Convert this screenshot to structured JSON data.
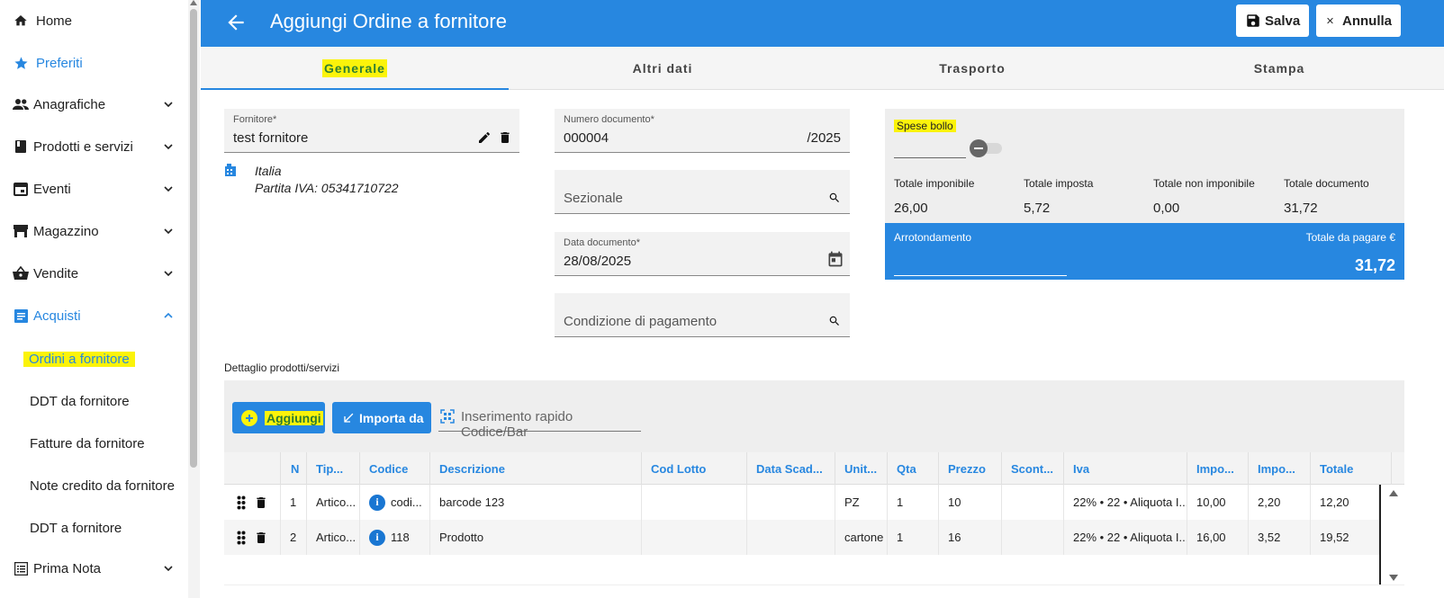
{
  "sidebar": {
    "items": [
      {
        "label": "Home",
        "icon": "home-icon"
      },
      {
        "label": "Preferiti",
        "icon": "star-icon"
      },
      {
        "label": "Anagrafiche",
        "icon": "people-icon"
      },
      {
        "label": "Prodotti e servizi",
        "icon": "book-icon"
      },
      {
        "label": "Eventi",
        "icon": "calendar-icon"
      },
      {
        "label": "Magazzino",
        "icon": "warehouse-icon"
      },
      {
        "label": "Vendite",
        "icon": "basket-icon"
      },
      {
        "label": "Acquisti",
        "icon": "list-icon"
      },
      {
        "label": "Prima Nota",
        "icon": "ledger-icon"
      }
    ],
    "subitems": [
      {
        "label": "Ordini a fornitore"
      },
      {
        "label": "DDT da fornitore"
      },
      {
        "label": "Fatture da fornitore"
      },
      {
        "label": "Note credito da fornitore"
      },
      {
        "label": "DDT a fornitore"
      }
    ]
  },
  "header": {
    "title": "Aggiungi Ordine a fornitore",
    "save_label": "Salva",
    "cancel_label": "Annulla"
  },
  "tabs": [
    {
      "label": "Generale"
    },
    {
      "label": "Altri dati"
    },
    {
      "label": "Trasporto"
    },
    {
      "label": "Stampa"
    }
  ],
  "form": {
    "fornitore_label": "Fornitore*",
    "fornitore_value": "test fornitore",
    "supplier_country": "Italia",
    "supplier_vat": "Partita IVA: 05341710722",
    "numero_label": "Numero documento*",
    "numero_value": "000004",
    "numero_suffix": "/2025",
    "sezionale_placeholder": "Sezionale",
    "data_label": "Data documento*",
    "data_value": "28/08/2025",
    "pagamento_placeholder": "Condizione di pagamento"
  },
  "totals": {
    "spese_bollo_label": "Spese bollo",
    "imponibile_label": "Totale imponibile",
    "imponibile_value": "26,00",
    "imposta_label": "Totale imposta",
    "imposta_value": "5,72",
    "non_imponibile_label": "Totale non imponibile",
    "non_imponibile_value": "0,00",
    "documento_label": "Totale documento",
    "documento_value": "31,72",
    "arrotondamento_label": "Arrotondamento",
    "da_pagare_label": "Totale da pagare €",
    "da_pagare_value": "31,72"
  },
  "detail": {
    "title": "Dettaglio prodotti/servizi",
    "add_label": "Aggiungi",
    "import_label": "Importa da",
    "quick_placeholder": "Inserimento rapido Codice/Bar",
    "columns": [
      "N",
      "Tip...",
      "Codice",
      "Descrizione",
      "Cod Lotto",
      "Data Scad...",
      "Unit...",
      "Qta",
      "Prezzo",
      "Scont...",
      "Iva",
      "Impo...",
      "Impo...",
      "Totale"
    ],
    "rows": [
      {
        "n": "1",
        "tipo": "Artico...",
        "codice": "codi...",
        "descrizione": "barcode 123",
        "lotto": "",
        "scadenza": "",
        "unita": "PZ",
        "qta": "1",
        "prezzo": "10",
        "sconto": "",
        "iva": "22% • 22 • Aliquota I...",
        "imponibile": "10,00",
        "imposta": "2,20",
        "totale": "12,20"
      },
      {
        "n": "2",
        "tipo": "Artico...",
        "codice": "118",
        "descrizione": "Prodotto",
        "lotto": "",
        "scadenza": "",
        "unita": "cartone",
        "qta": "1",
        "prezzo": "16",
        "sconto": "",
        "iva": "22% • 22 • Aliquota I...",
        "imponibile": "16,00",
        "imposta": "3,52",
        "totale": "19,52"
      }
    ]
  },
  "colors": {
    "primary": "#2787e0",
    "highlight": "#fbf30a",
    "panel": "#eeeeee"
  }
}
